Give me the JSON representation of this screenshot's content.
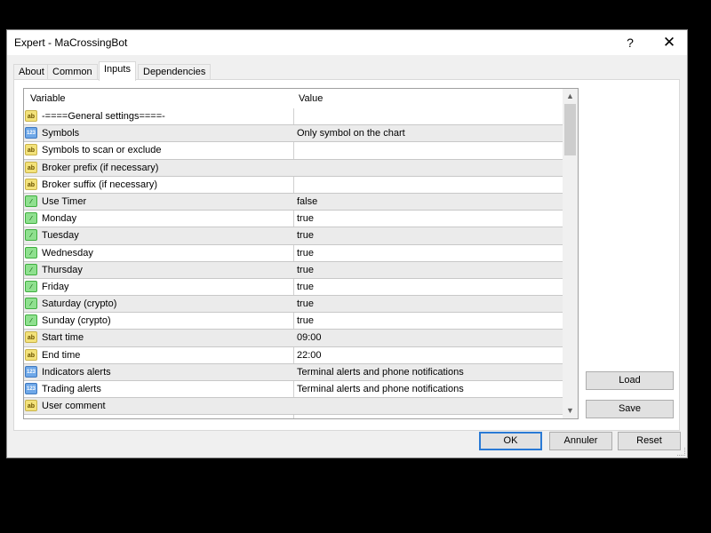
{
  "window": {
    "title": "Expert - MaCrossingBot",
    "help_label": "?",
    "close_label": "✕"
  },
  "tabs": [
    {
      "label": "About",
      "active": false
    },
    {
      "label": "Common",
      "active": false
    },
    {
      "label": "Inputs",
      "active": true
    },
    {
      "label": "Dependencies",
      "active": false
    }
  ],
  "grid": {
    "columns": {
      "variable": "Variable",
      "value": "Value"
    },
    "rows": [
      {
        "icon": "ab",
        "variable": "-====General settings====-",
        "value": ""
      },
      {
        "icon": "num",
        "variable": "Symbols",
        "value": "Only symbol on the chart"
      },
      {
        "icon": "ab",
        "variable": "Symbols to scan or exclude",
        "value": ""
      },
      {
        "icon": "ab",
        "variable": "Broker prefix (if necessary)",
        "value": ""
      },
      {
        "icon": "ab",
        "variable": "Broker suffix (if necessary)",
        "value": ""
      },
      {
        "icon": "bool",
        "variable": "Use Timer",
        "value": "false"
      },
      {
        "icon": "bool",
        "variable": "Monday",
        "value": "true"
      },
      {
        "icon": "bool",
        "variable": "Tuesday",
        "value": "true"
      },
      {
        "icon": "bool",
        "variable": "Wednesday",
        "value": "true"
      },
      {
        "icon": "bool",
        "variable": "Thursday",
        "value": "true"
      },
      {
        "icon": "bool",
        "variable": "Friday",
        "value": "true"
      },
      {
        "icon": "bool",
        "variable": "Saturday (crypto)",
        "value": "true"
      },
      {
        "icon": "bool",
        "variable": "Sunday (crypto)",
        "value": "true"
      },
      {
        "icon": "ab",
        "variable": "Start time",
        "value": "09:00"
      },
      {
        "icon": "ab",
        "variable": "End time",
        "value": "22:00"
      },
      {
        "icon": "num",
        "variable": "Indicators alerts",
        "value": "Terminal alerts and phone notifications"
      },
      {
        "icon": "num",
        "variable": "Trading alerts",
        "value": "Terminal alerts and phone notifications"
      },
      {
        "icon": "ab",
        "variable": "User comment",
        "value": ""
      }
    ],
    "icon_glyphs": {
      "ab": "ab",
      "num": "123",
      "bool": "⁄"
    }
  },
  "side_buttons": {
    "load": "Load",
    "save": "Save"
  },
  "footer": {
    "ok": "OK",
    "cancel": "Annuler",
    "reset": "Reset"
  }
}
